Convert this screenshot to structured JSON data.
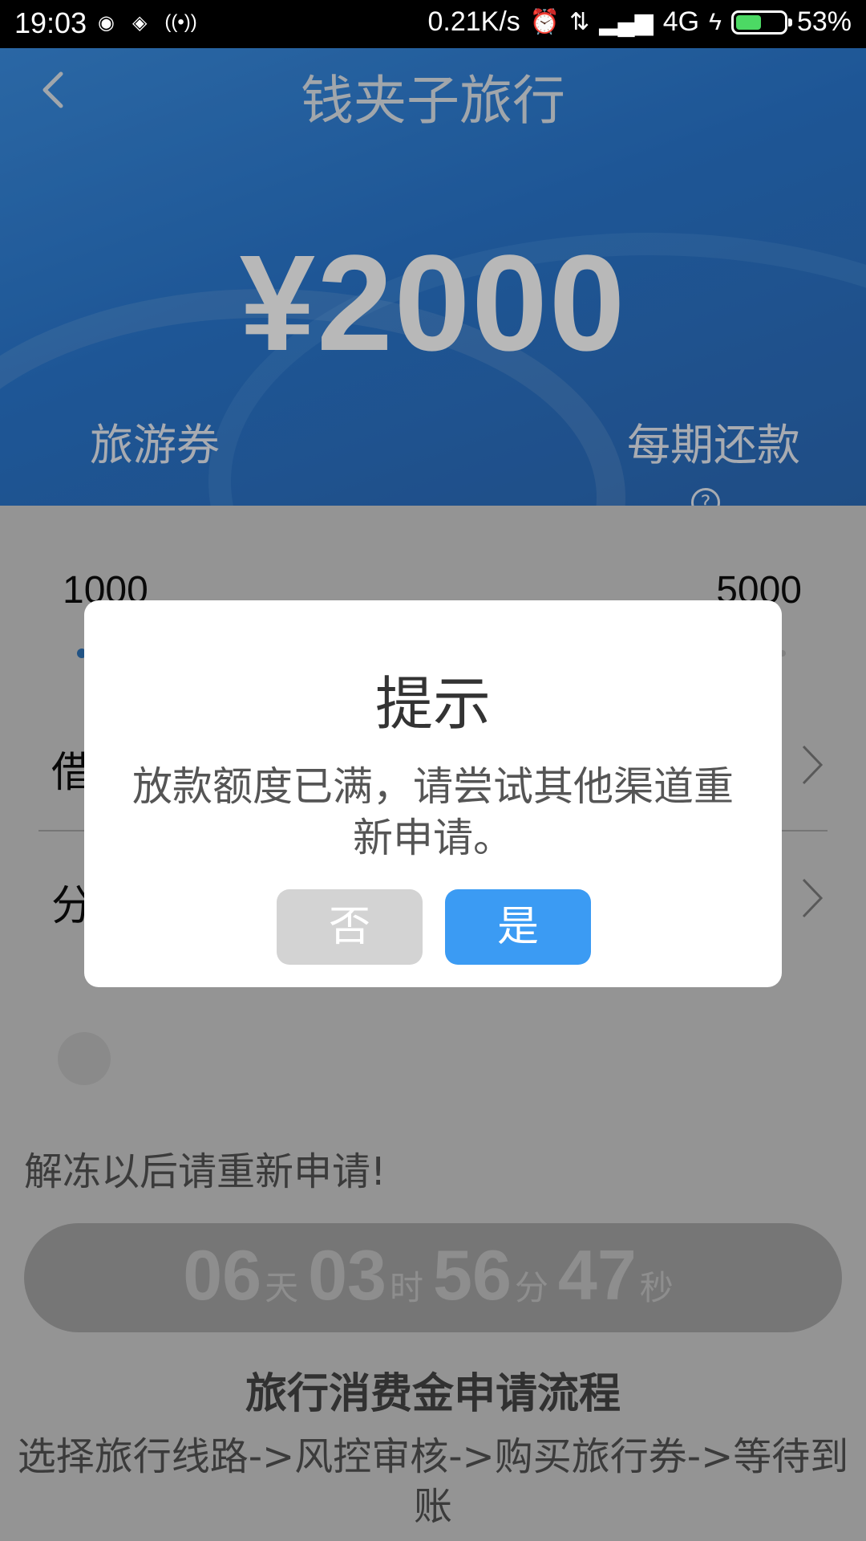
{
  "status_bar": {
    "time": "19:03",
    "notif_icons": [
      "weibo-icon",
      "sync-icon",
      "hotspot-icon"
    ],
    "net_speed": "0.21K/s",
    "network": "4G",
    "battery": "53%",
    "battery_level": 0.53
  },
  "header": {
    "title": "钱夹子旅行",
    "amount": "¥2000",
    "label_left": "旅游券",
    "label_right": "每期还款",
    "help_glyph": "?"
  },
  "slider": {
    "min": "1000",
    "max": "5000"
  },
  "rows": [
    {
      "label": "借"
    },
    {
      "label": "分"
    }
  ],
  "notice": "解冻以后请重新申请!",
  "countdown": {
    "days": "06",
    "days_unit": "天",
    "hours": "03",
    "hours_unit": "时",
    "minutes": "56",
    "minutes_unit": "分",
    "seconds": "47",
    "seconds_unit": "秒"
  },
  "process": {
    "title": "旅行消费金申请流程",
    "steps": "选择旅行线路->风控审核->购买旅行券->等待到账"
  },
  "dialog": {
    "title": "提示",
    "message": "放款额度已满，请尝试其他渠道重新申请。",
    "no_label": "否",
    "yes_label": "是"
  },
  "colors": {
    "accent_blue": "#3b9bf3",
    "header_blue": "#2a78d0",
    "battery_green": "#4cd964"
  }
}
